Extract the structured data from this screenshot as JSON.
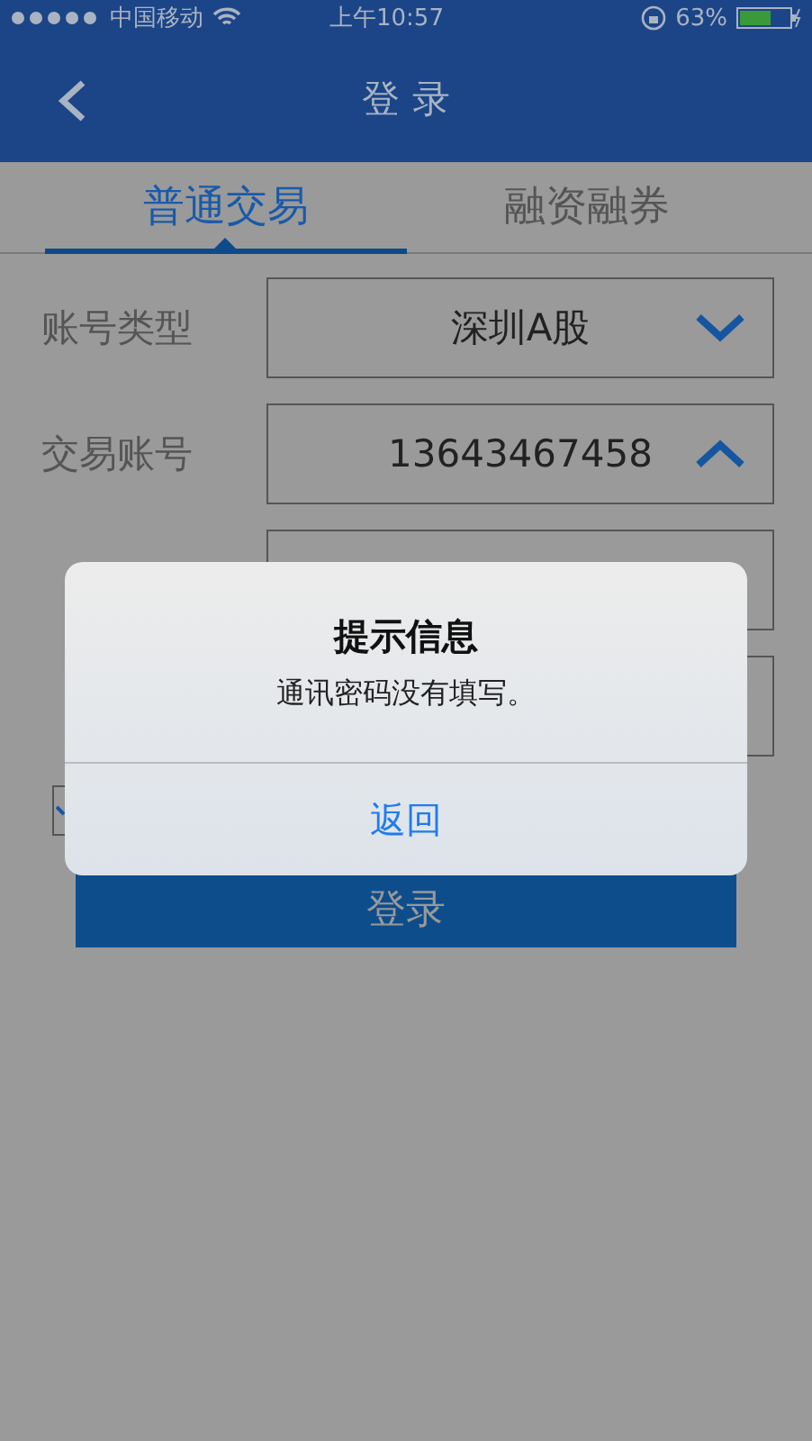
{
  "status_bar": {
    "carrier": "中国移动",
    "time": "上午10:57",
    "battery": "63%"
  },
  "nav_bar": {
    "title": "登 录"
  },
  "tabs": [
    {
      "label": "普通交易",
      "selected": true
    },
    {
      "label": "融资融券",
      "selected": false
    }
  ],
  "form": [
    {
      "label": "账号类型",
      "value": "深圳A股",
      "kind": "select",
      "expanded": false
    },
    {
      "label": "交易账号",
      "value": "13643467458",
      "kind": "select",
      "expanded": true
    },
    {
      "kind": "input"
    },
    {
      "kind": "input"
    }
  ],
  "remember": {
    "checked": true
  },
  "login_button": "登录",
  "alert": {
    "title": "提示信息",
    "message": "通讯密码没有填写。",
    "button": "返回"
  }
}
